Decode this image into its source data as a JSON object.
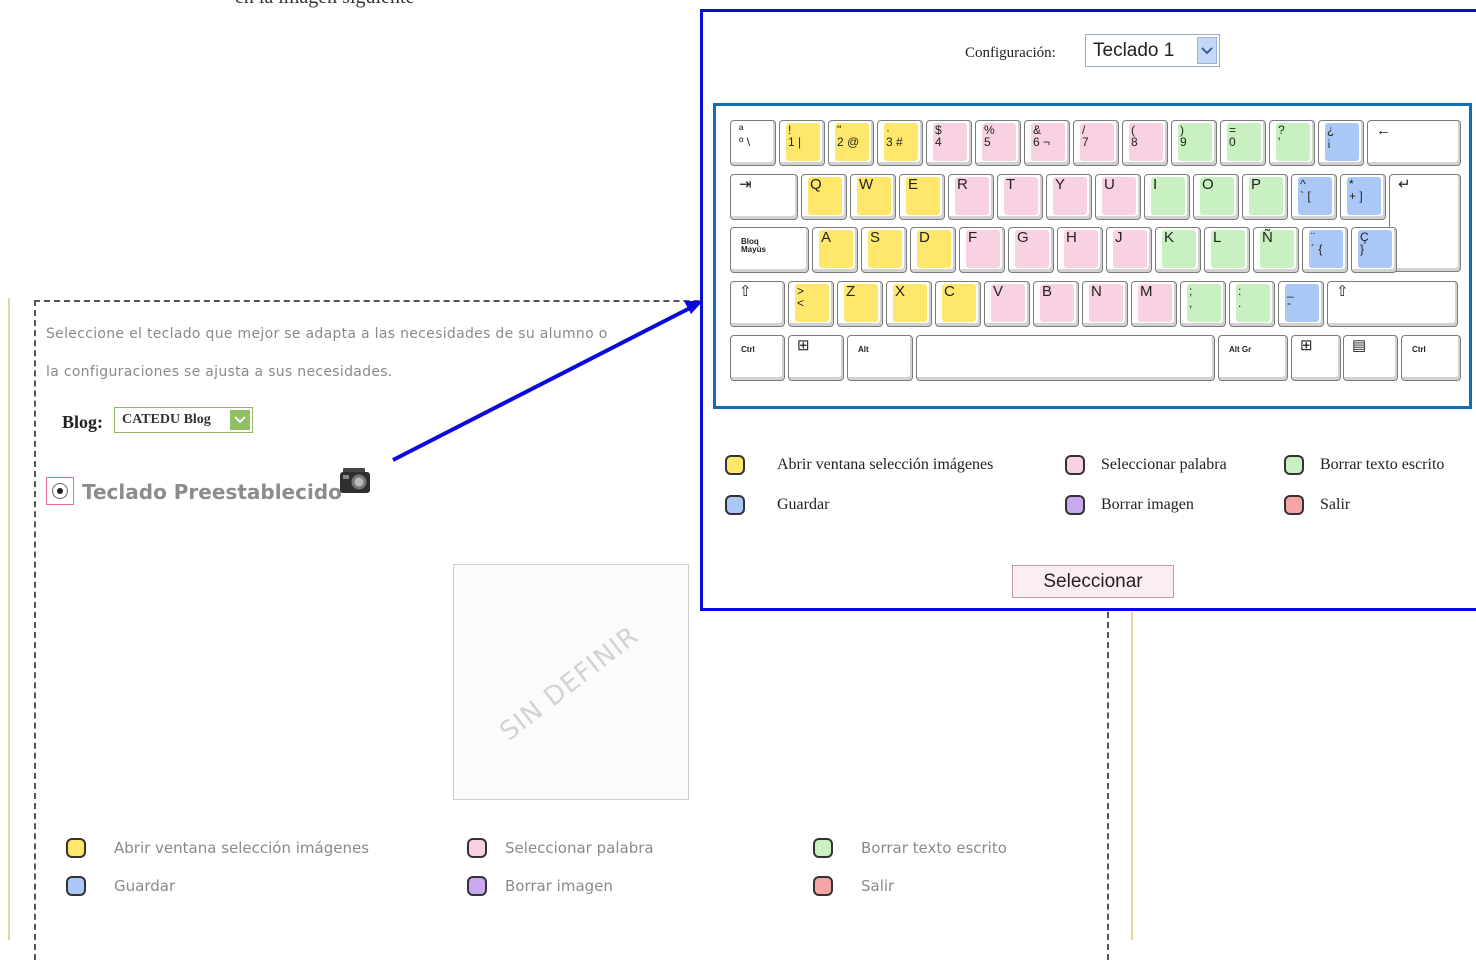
{
  "top_text": "en la imagen siguiente",
  "description": {
    "line1": "Seleccione el teclado que mejor se adapta a las necesidades de su alumno o",
    "line2": "la configuraciones se ajusta a sus necesidades."
  },
  "blog": {
    "label": "Blog:",
    "value": "CATEDU Blog"
  },
  "preset": {
    "label": "Teclado Preestablecido",
    "checked": true
  },
  "preview": {
    "placeholder": "SIN DEFINIR"
  },
  "legend": [
    {
      "label": "Abrir ventana selección imágenes",
      "color": "#ffe76b"
    },
    {
      "label": "Guardar",
      "color": "#a9c8f5"
    },
    {
      "label": "Seleccionar palabra",
      "color": "#f8d2e2"
    },
    {
      "label": "Borrar imagen",
      "color": "#c9a8ef"
    },
    {
      "label": "Borrar texto escrito",
      "color": "#c8f0c0"
    },
    {
      "label": "Salir",
      "color": "#f6a4a6"
    }
  ],
  "popup": {
    "config_label": "Configuración:",
    "config_value": "Teclado 1",
    "submit_label": "Seleccionar"
  },
  "keyboard": {
    "key_colors": {
      "yellow": "#ffe76b",
      "pink": "#f8d2e2",
      "green": "#c8f0c0",
      "blue": "#a9c8f5",
      "none": ""
    },
    "rows": [
      [
        {
          "label": "ª\nº \\",
          "color": "none"
        },
        {
          "label": "!\n1 |",
          "color": "yellow"
        },
        {
          "label": "\"\n2 @",
          "color": "yellow"
        },
        {
          "label": "·\n3 #",
          "color": "yellow"
        },
        {
          "label": "$\n4",
          "color": "pink"
        },
        {
          "label": "%\n5",
          "color": "pink"
        },
        {
          "label": "&\n6 ¬",
          "color": "pink"
        },
        {
          "label": "/\n7",
          "color": "pink"
        },
        {
          "label": "(\n8",
          "color": "pink"
        },
        {
          "label": ")\n9",
          "color": "green"
        },
        {
          "label": "=\n0",
          "color": "green"
        },
        {
          "label": "?\n'",
          "color": "green"
        },
        {
          "label": "¿\n¡",
          "color": "blue"
        },
        {
          "label": "←",
          "color": "none"
        }
      ],
      [
        {
          "label": "⇥",
          "color": "none"
        },
        {
          "label": "Q",
          "color": "yellow"
        },
        {
          "label": "W",
          "color": "yellow"
        },
        {
          "label": "E",
          "color": "yellow"
        },
        {
          "label": "R",
          "color": "pink"
        },
        {
          "label": "T",
          "color": "pink"
        },
        {
          "label": "Y",
          "color": "pink"
        },
        {
          "label": "U",
          "color": "pink"
        },
        {
          "label": "I",
          "color": "green"
        },
        {
          "label": "O",
          "color": "green"
        },
        {
          "label": "P",
          "color": "green"
        },
        {
          "label": "^\n` [",
          "color": "blue"
        },
        {
          "label": "*\n+ ]",
          "color": "blue"
        },
        {
          "label": "↵",
          "color": "none"
        }
      ],
      [
        {
          "label": "Bloq\nMayús",
          "color": "none"
        },
        {
          "label": "A",
          "color": "yellow"
        },
        {
          "label": "S",
          "color": "yellow"
        },
        {
          "label": "D",
          "color": "yellow"
        },
        {
          "label": "F",
          "color": "pink"
        },
        {
          "label": "G",
          "color": "pink"
        },
        {
          "label": "H",
          "color": "pink"
        },
        {
          "label": "J",
          "color": "pink"
        },
        {
          "label": "K",
          "color": "green"
        },
        {
          "label": "L",
          "color": "green"
        },
        {
          "label": "Ñ",
          "color": "green"
        },
        {
          "label": "¨\n´ {",
          "color": "blue"
        },
        {
          "label": "Ç\n}",
          "color": "blue"
        }
      ],
      [
        {
          "label": "⇧",
          "color": "none"
        },
        {
          "label": ">\n<",
          "color": "yellow"
        },
        {
          "label": "Z",
          "color": "yellow"
        },
        {
          "label": "X",
          "color": "yellow"
        },
        {
          "label": "C",
          "color": "yellow"
        },
        {
          "label": "V",
          "color": "pink"
        },
        {
          "label": "B",
          "color": "pink"
        },
        {
          "label": "N",
          "color": "pink"
        },
        {
          "label": "M",
          "color": "pink"
        },
        {
          "label": ";\n,",
          "color": "green"
        },
        {
          "label": ":\n.",
          "color": "green"
        },
        {
          "label": "_\n-",
          "color": "blue"
        },
        {
          "label": "⇧",
          "color": "none"
        }
      ],
      [
        {
          "label": "Ctrl",
          "color": "none"
        },
        {
          "label": "⊞",
          "color": "none"
        },
        {
          "label": "Alt",
          "color": "none"
        },
        {
          "label": "",
          "color": "none"
        },
        {
          "label": "Alt Gr",
          "color": "none"
        },
        {
          "label": "⊞",
          "color": "none"
        },
        {
          "label": "▤",
          "color": "none"
        },
        {
          "label": "Ctrl",
          "color": "none"
        }
      ]
    ]
  }
}
